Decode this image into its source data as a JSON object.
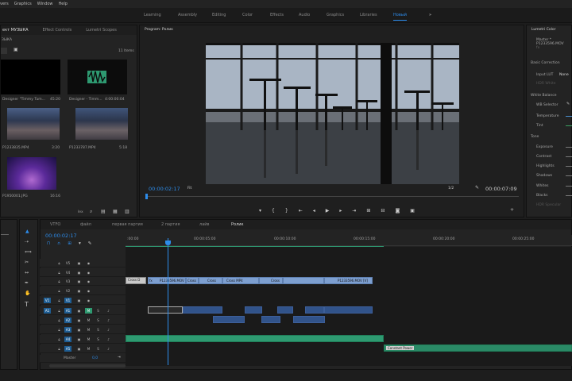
{
  "menu": [
    "vers",
    "Graphics",
    "Window",
    "Help"
  ],
  "workspaces": [
    "Learning",
    "Assembly",
    "Editing",
    "Color",
    "Effects",
    "Audio",
    "Graphics",
    "Libraries",
    "Новый",
    "»"
  ],
  "project": {
    "tabs": [
      "ект МУЗЫКА",
      "Effect Controls",
      "Lumetri Scopes"
    ],
    "subtitle": "ЗЫКА",
    "items_count": "11 Items",
    "items": [
      {
        "name": "Designer \"Timmy Tum...",
        "dur": "45:20"
      },
      {
        "name": "Designer - Timm...",
        "dur": "4:00:00:04"
      },
      {
        "name": "P1233835.MP4",
        "dur": "3:20"
      },
      {
        "name": "P1233787.MP4",
        "dur": "5:18"
      },
      {
        "name": "P1950001.JPG",
        "dur": "16:16"
      }
    ],
    "zoom_label": "lex"
  },
  "program": {
    "title": "Program: Ролик",
    "timecode": "00:00:02:17",
    "fit": "Fit",
    "quality": "1/2",
    "duration": "00:00:07:09"
  },
  "lumetri": {
    "title": "Lumetri Color",
    "master": "Master * P1233596.MOV",
    "fx": "fx",
    "basic_correction": "Basic Correction",
    "input_lut": "Input LUT",
    "input_lut_value": "None",
    "hdr_white": "HDR White",
    "white_balance": "White Balance",
    "wb_selector": "WB Selector",
    "temperature": "Temperature",
    "tint": "Tint",
    "tone": "Tone",
    "exposure": "Exposure",
    "contrast": "Contrast",
    "highlights": "Highlights",
    "shadows": "Shadows",
    "whites": "Whites",
    "blacks": "Blacks",
    "hdr_specular": "HDR Specular"
  },
  "timeline": {
    "tabs": [
      "VTFO",
      "файл",
      "первая партия",
      "2 партия",
      "лайв",
      "Ролик"
    ],
    "timecode": "00:00:02:17",
    "ruler": [
      ":00:00",
      "00:00:05:00",
      "00:00:10:00",
      "00:00:15:00",
      "00:00:20:00",
      "00:00:25:00"
    ],
    "video_tracks": [
      "V5",
      "V4",
      "V3",
      "V2",
      "V1"
    ],
    "audio_tracks": [
      "A1",
      "A2",
      "A3",
      "A4",
      "A5"
    ],
    "master": "Master",
    "master_value": "0,0",
    "clips": {
      "cross1": "Cross D",
      "p1": "P1233596.MOV",
      "cross2": "Cross",
      "cross3": "Cross",
      "clip4": "Cross MP4",
      "cross5": "Cross",
      "clip6": "P1233596.MOV [V]",
      "constant_power": "Constant Power"
    }
  },
  "colors": {
    "accent": "#2d8ceb",
    "clip_video": "#7d9fd0",
    "clip_audio": "#31538a",
    "clip_green": "#2e9a71"
  }
}
